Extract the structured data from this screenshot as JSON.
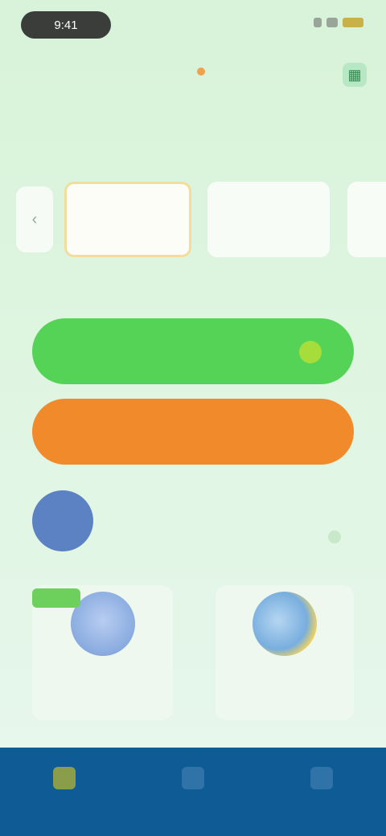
{
  "status": {
    "time": "9:41"
  },
  "calendar": {
    "month": "",
    "legend": "",
    "weekdays": [
      "",
      "",
      "",
      "",
      "",
      "",
      ""
    ],
    "dates": [
      "",
      "",
      "",
      "",
      "",
      "",
      ""
    ]
  },
  "slots": [
    {
      "line1": "",
      "line2": ""
    },
    {
      "line1": "",
      "line2": ""
    },
    {
      "line1": "",
      "line2": ""
    }
  ],
  "info_link": "",
  "buttons": {
    "primary": "",
    "secondary": ""
  },
  "promo": {
    "title": "",
    "subtitle": ""
  },
  "cards": [
    {
      "tag": "",
      "label": ""
    },
    {
      "label": ""
    }
  ],
  "tabs": [
    {
      "label": "",
      "icon": "home-icon"
    },
    {
      "label": "",
      "icon": "list-icon"
    },
    {
      "label": "",
      "icon": "user-icon"
    }
  ],
  "colors": {
    "primary_green": "#54d357",
    "orange": "#f18a2a",
    "tabbar": "#0e5b95"
  }
}
